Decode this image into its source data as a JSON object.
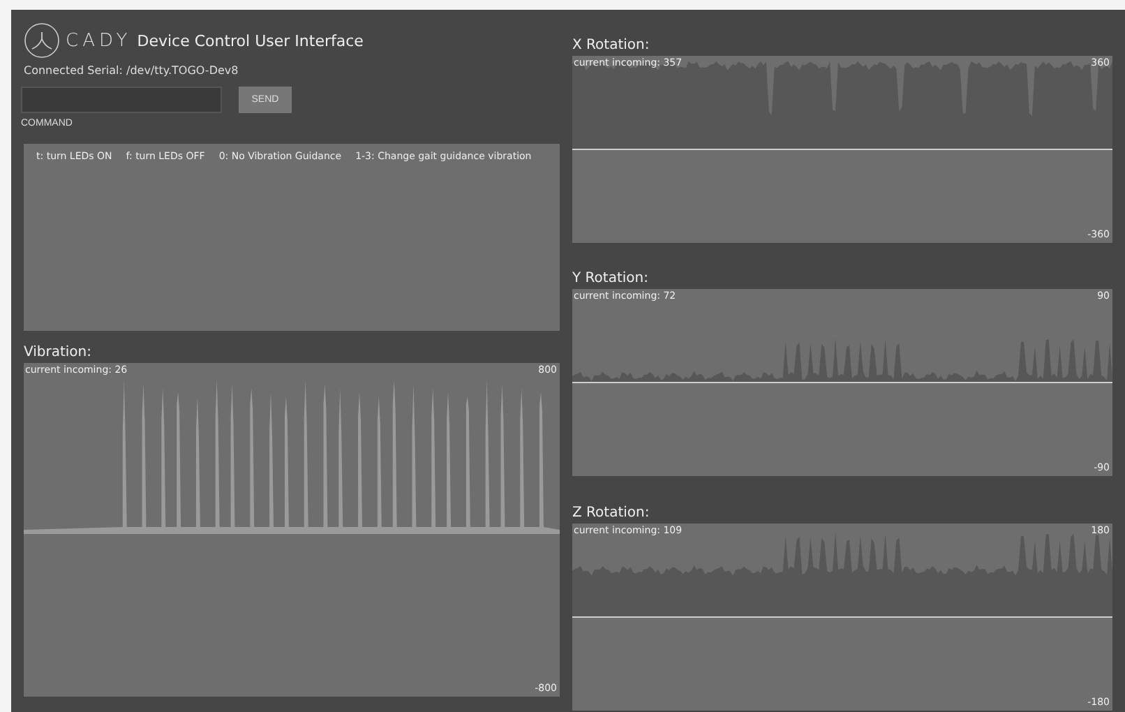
{
  "header": {
    "logo_text": "CADY",
    "title": "Device Control User Interface",
    "serial": "Connected Serial: /dev/tty.TOGO-Dev8"
  },
  "command": {
    "label": "COMMAND",
    "button": "SEND"
  },
  "console": {
    "hints": [
      "t: turn LEDs ON",
      "f: turn LEDs OFF",
      "0: No Vibration Guidance",
      "1-3: Change gait guidance vibration"
    ]
  },
  "vibration": {
    "title": "Vibration:",
    "current": "current incoming: 26",
    "max": "800",
    "min": "-800",
    "kind": "spikes"
  },
  "rotations": [
    {
      "title": "X Rotation:",
      "current": "current incoming: 357",
      "max": "360",
      "min": "-360",
      "kind": "high"
    },
    {
      "title": "Y Rotation:",
      "current": "current incoming: 72",
      "max": "90",
      "min": "-90",
      "kind": "low"
    },
    {
      "title": "Z Rotation:",
      "current": "current incoming: 109",
      "max": "180",
      "min": "-180",
      "kind": "mid"
    }
  ]
}
